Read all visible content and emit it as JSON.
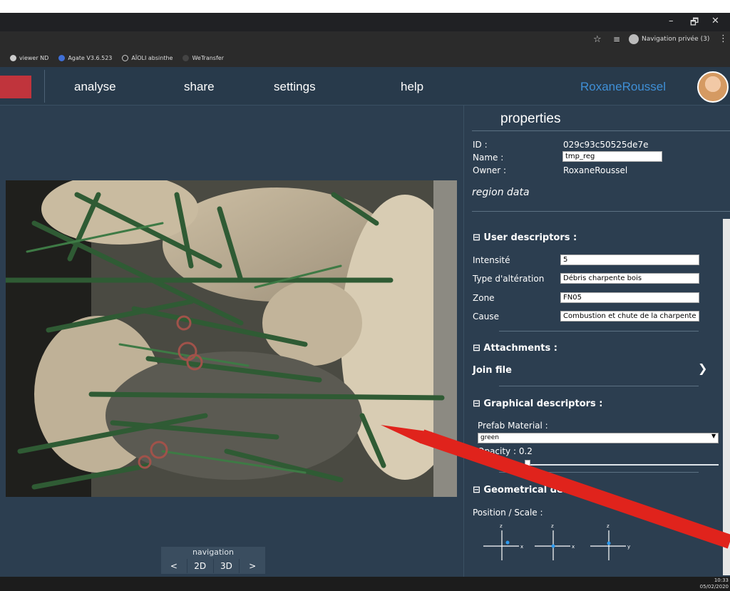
{
  "window": {
    "minimize": "–",
    "maximize": "🗗",
    "close": "✕"
  },
  "browser": {
    "private_label": "Navigation privée (3)",
    "bookmarks": [
      {
        "label": "viewer ND",
        "color": "#cccccc"
      },
      {
        "label": "Agate V3.6.523",
        "color": "#3f6fd6"
      },
      {
        "label": "AÏOLI absinthe",
        "color": "#cccccc"
      },
      {
        "label": "WeTransfer",
        "color": "#444444"
      }
    ]
  },
  "nav": {
    "items": [
      "analyse",
      "share",
      "settings",
      "help"
    ],
    "user": "RoxaneRoussel"
  },
  "properties": {
    "title": "properties",
    "id_label": "ID :",
    "id_value": "029c93c50525de7e",
    "name_label": "Name :",
    "name_value": "tmp_reg",
    "owner_label": "Owner :",
    "owner_value": "RoxaneRoussel",
    "region_data": "region data"
  },
  "user_descriptors": {
    "header": "⊟ User descriptors :",
    "fields": [
      {
        "label": "Intensité",
        "value": "5"
      },
      {
        "label": "Type d'altération",
        "value": "Débris charpente bois"
      },
      {
        "label": "Zone",
        "value": "FN05"
      },
      {
        "label": "Cause",
        "value": "Combustion et chute de la charpente"
      }
    ]
  },
  "attachments": {
    "header": "⊟ Attachments :",
    "join": "Join file"
  },
  "graphical": {
    "header": "⊟ Graphical descriptors :",
    "prefab_label": "Prefab Material :",
    "prefab_value": "green",
    "opacity_label": "Opacity : 0.2",
    "opacity": 0.2
  },
  "geometrical": {
    "header": "⊟ Geometrical descri",
    "position_label": "Position / Scale :",
    "gizmos": [
      {
        "up": "z",
        "right": "x"
      },
      {
        "up": "z",
        "right": "x"
      },
      {
        "up": "z",
        "right": "y"
      }
    ]
  },
  "navigation": {
    "label": "navigation",
    "buttons": [
      "<",
      "2D",
      "3D",
      ">"
    ]
  },
  "clock": {
    "time": "10:33",
    "date": "05/02/2020"
  }
}
